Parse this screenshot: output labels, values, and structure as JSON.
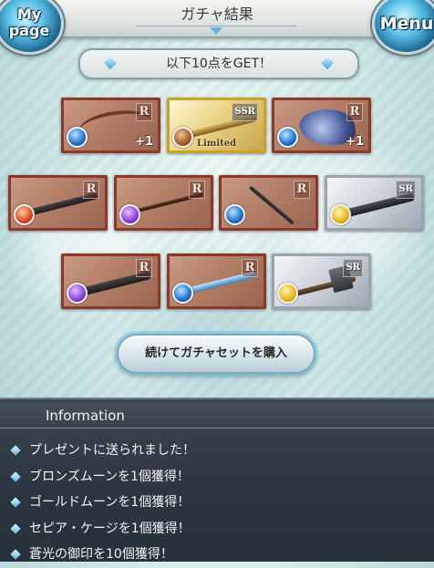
{
  "header": {
    "title": "ガチャ結果",
    "mypage_label": "My page",
    "menu_label": "Menu"
  },
  "banner": {
    "text": "以下10点をGET！"
  },
  "items": [
    {
      "rarity": "R",
      "element": "water-icon",
      "weapon": "bow",
      "badge": "+1"
    },
    {
      "rarity": "SSR",
      "element": "earth-icon",
      "weapon": "staff",
      "badge": "Limited"
    },
    {
      "rarity": "R",
      "element": "water-icon",
      "weapon": "winged-blade",
      "badge": "+1"
    },
    {
      "rarity": "R",
      "element": "fire-icon",
      "weapon": "gun",
      "badge": ""
    },
    {
      "rarity": "R",
      "element": "dark-icon",
      "weapon": "staff",
      "badge": ""
    },
    {
      "rarity": "R",
      "element": "water-icon",
      "weapon": "scythe",
      "badge": ""
    },
    {
      "rarity": "SR",
      "element": "light-icon",
      "weapon": "gun",
      "badge": ""
    },
    {
      "rarity": "R",
      "element": "dark-icon",
      "weapon": "sword",
      "badge": ""
    },
    {
      "rarity": "R",
      "element": "water-icon",
      "weapon": "spear",
      "badge": ""
    },
    {
      "rarity": "SR",
      "element": "light-icon",
      "weapon": "hammer",
      "badge": ""
    }
  ],
  "buy_button": {
    "label": "続けてガチャセットを購入"
  },
  "information": {
    "title": "Information",
    "messages": [
      "プレゼントに送られました！",
      "ブロンズムーンを1個獲得！",
      "ゴールドムーンを1個獲得！",
      "セピア・ケージを1個獲得！",
      "蒼光の御印を10個獲得！"
    ]
  }
}
